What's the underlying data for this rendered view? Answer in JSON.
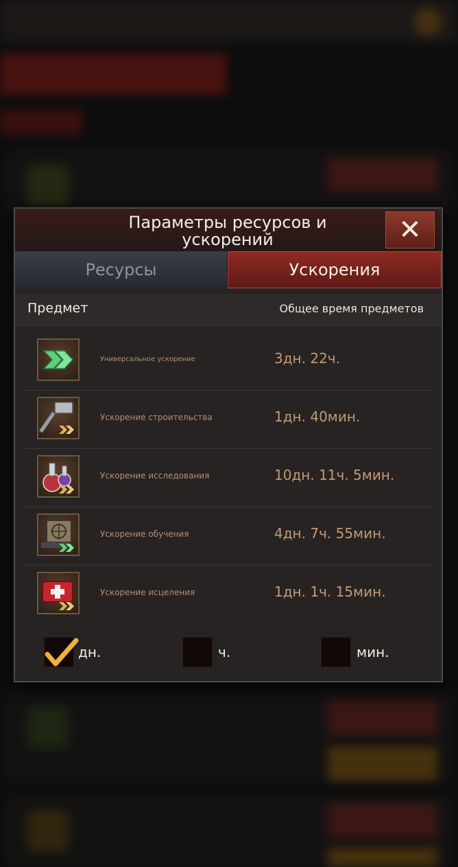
{
  "dialog": {
    "title": "Параметры ресурсов и ускорений",
    "close_glyph": "✕",
    "tabs": [
      {
        "label": "Ресурсы",
        "active": false
      },
      {
        "label": "Ускорения",
        "active": true
      }
    ],
    "header": {
      "item": "Предмет",
      "total_time": "Общее время предметов"
    },
    "items": [
      {
        "name": "Универсальное ускорение",
        "time": "3дн. 22ч.",
        "icon": "green-chevrons-icon"
      },
      {
        "name": "Ускорение строительства",
        "time": "1дн. 40мин.",
        "icon": "hammer-icon"
      },
      {
        "name": "Ускорение исследования",
        "time": "10дн. 11ч. 5мин.",
        "icon": "flask-icon"
      },
      {
        "name": "Ускорение обучения",
        "time": "4дн. 7ч. 55мин.",
        "icon": "target-board-icon"
      },
      {
        "name": "Ускорение исцеления",
        "time": "1дн. 1ч. 15мин.",
        "icon": "medkit-icon"
      }
    ],
    "units": [
      {
        "label": "дн.",
        "checked": true
      },
      {
        "label": "ч.",
        "checked": false
      },
      {
        "label": "мин.",
        "checked": false
      }
    ]
  },
  "colors": {
    "accent_red": "#8e2a22",
    "time_text": "#c59a73",
    "check": "#f0b03a"
  }
}
